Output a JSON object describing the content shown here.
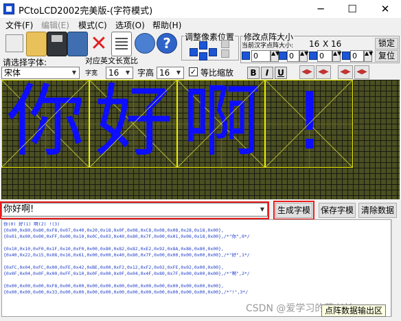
{
  "window": {
    "title": "PCtoLCD2002完美版-(字符模式)",
    "minimize": "─",
    "maximize": "☐",
    "close": "✕"
  },
  "menu": [
    {
      "label": "文件(F)",
      "disabled": false
    },
    {
      "label": "编辑(E)",
      "disabled": true
    },
    {
      "label": "模式(C)",
      "disabled": false
    },
    {
      "label": "选项(O)",
      "disabled": false
    },
    {
      "label": "帮助(H)",
      "disabled": false
    }
  ],
  "toolbar": {
    "icons": [
      "open-icon",
      "save-icon",
      "save-as-icon",
      "clear-icon",
      "doc-icon",
      "settings-icon",
      "help-icon"
    ],
    "clear_glyph": "✕",
    "help_glyph": "?"
  },
  "pixel_position": {
    "title": "调整像素位置"
  },
  "resize": {
    "title": "修改点阵大小",
    "current_size_label": "当前汉字点阵大小:",
    "width": "16",
    "x": "X",
    "height": "16",
    "lock_button": "锁定",
    "restore_button": "复位",
    "spin_values": [
      "0",
      "0",
      "0",
      "0"
    ]
  },
  "font_row": {
    "font_label": "请选择字体:",
    "font_value": "宋体",
    "ascii_label": "对应英文长宽比",
    "char_width_label": "字宽",
    "char_width_value": "16",
    "char_height_label": "字高",
    "char_height_value": "16",
    "proportional_label": "等比缩放",
    "proportional_checked": true,
    "bold": "B",
    "italic": "I",
    "underline": "U"
  },
  "canvas": {
    "glyphs": [
      "你",
      "好",
      "啊",
      "!"
    ],
    "dot_color": "#0d0dff",
    "background": "#4b4f22",
    "cell_border": "#f0f000"
  },
  "input": {
    "text": "你好啊!"
  },
  "buttons": {
    "generate": "生成字模",
    "save_model": "保存字模",
    "clear_data": "清除数据"
  },
  "output": {
    "header": "你(0) 好(1) 啊(2) !(3)",
    "lines": [
      "{0x00,0x80,0x80,0xF8,0x07,0x40,0x20,0x18,0x0F,0x08,0xC8,0x08,0x08,0x28,0x18,0x00},",
      "{0x01,0x00,0x00,0xFF,0x00,0x10,0x0C,0x03,0x40,0x80,0x7F,0x00,0x01,0x06,0x18,0x00},/*\"你\",0*/",
      "",
      "{0x10,0x10,0xF0,0x1F,0x10,0xF0,0x00,0x80,0x82,0x82,0xE2,0x92,0x8A,0x86,0x80,0x00},",
      "{0x40,0x22,0x15,0x08,0x16,0x61,0x00,0x00,0x40,0x80,0x7F,0x00,0x00,0x00,0x00,0x00},/*\"好\",1*/",
      "",
      "{0xFC,0x04,0xFC,0x00,0xFE,0x42,0xBE,0x00,0xF2,0x12,0xF2,0x02,0xFE,0x02,0x00,0x00},",
      "{0x0F,0x04,0x0F,0x00,0xFF,0x10,0x0F,0x00,0x0F,0x04,0x4F,0x80,0x7F,0x00,0x00,0x00},/*\"啊\",2*/",
      "",
      "{0x00,0x00,0x00,0xF8,0x00,0x00,0x00,0x00,0x00,0x00,0x00,0x00,0x00,0x00,0x00,0x00},",
      "{0x00,0x00,0x00,0x33,0x00,0x00,0x00,0x00,0x00,0x00,0x00,0x00,0x00,0x00,0x00,0x00},/*\"!\",3*/"
    ]
  },
  "tooltip": "点阵数据输出区",
  "watermark": "CSDN @爱学习的蕾兴长"
}
